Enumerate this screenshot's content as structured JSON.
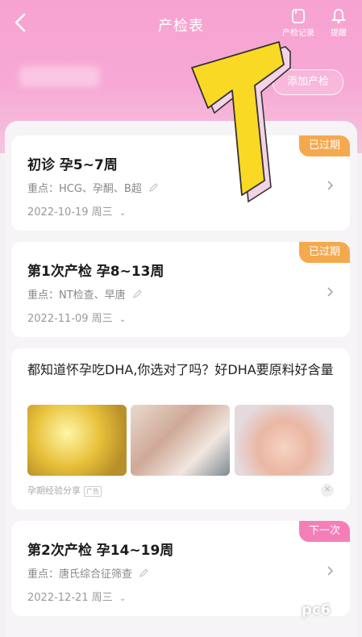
{
  "header": {
    "title": "产检表",
    "record_label": "产检记录",
    "remind_label": "提醒",
    "add_label": "添加产检"
  },
  "checkups": [
    {
      "title": "初诊  孕5~7周",
      "focus": "重点：HCG、孕酮、B超",
      "date": "2022-10-19 周三",
      "badge": "已过期"
    },
    {
      "title": "第1次产检  孕8~13周",
      "focus": "重点：NT检查、早唐",
      "date": "2022-11-09 周三",
      "badge": "已过期"
    },
    {
      "title": "第2次产检  孕14~19周",
      "focus": "重点：唐氏综合征筛查",
      "date": "2022-12-21 周三",
      "badge": "下一次"
    }
  ],
  "ad": {
    "title": "都知道怀孕吃DHA,你选对了吗？好DHA要原料好含量",
    "source": "孕期经验分享",
    "tag": "广告"
  },
  "watermark": "pc6",
  "colors": {
    "expired": "#f5a94e",
    "next": "#f47fb8",
    "header_pink": "#f7a3d2"
  }
}
